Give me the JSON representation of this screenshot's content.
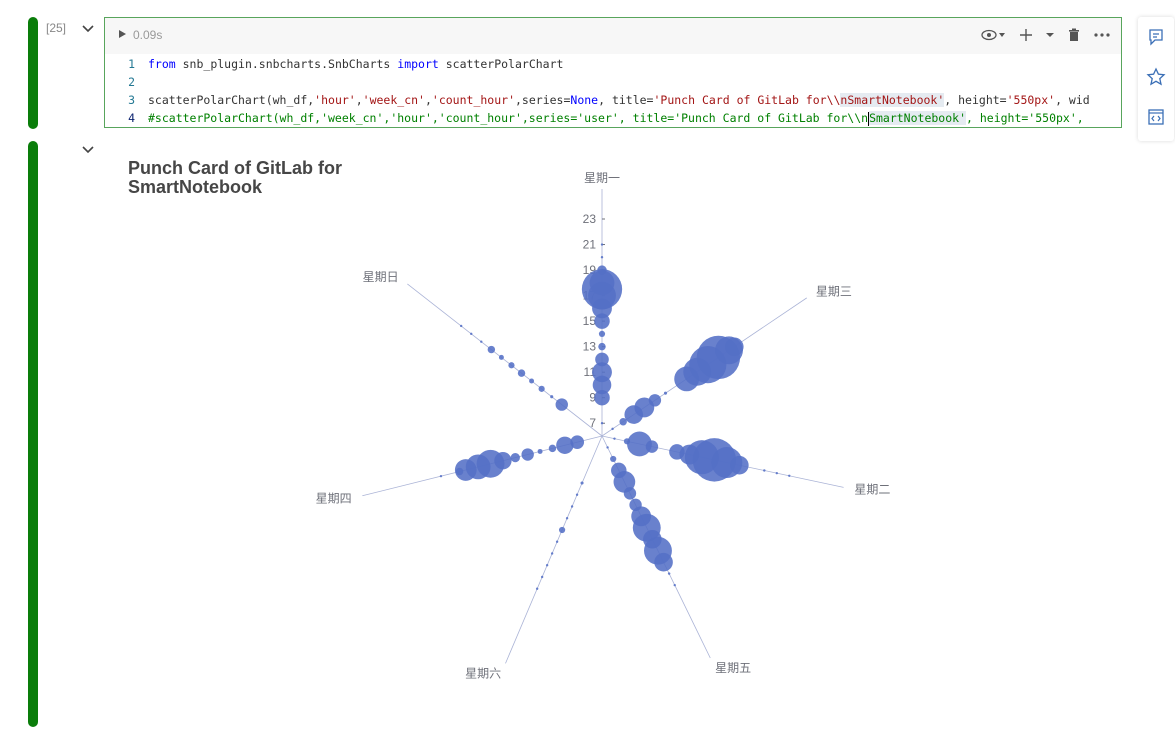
{
  "cell": {
    "execution_count": "[25]",
    "run_time": "0.09s",
    "code_lines": [
      {
        "number": "1",
        "segments": [
          {
            "t": "from",
            "c": "kw"
          },
          {
            "t": " snb_plugin.snbcharts.SnbCharts ",
            "c": ""
          },
          {
            "t": "import",
            "c": "kw"
          },
          {
            "t": " scatterPolarChart",
            "c": ""
          }
        ]
      },
      {
        "number": "2",
        "segments": []
      },
      {
        "number": "3",
        "segments": [
          {
            "t": "scatterPolarChart(wh_df,",
            "c": ""
          },
          {
            "t": "'hour'",
            "c": "str"
          },
          {
            "t": ",",
            "c": ""
          },
          {
            "t": "'week_cn'",
            "c": "str"
          },
          {
            "t": ",",
            "c": ""
          },
          {
            "t": "'count_hour'",
            "c": "str"
          },
          {
            "t": ",series=",
            "c": ""
          },
          {
            "t": "None",
            "c": "kw"
          },
          {
            "t": ", title=",
            "c": ""
          },
          {
            "t": "'Punch Card of GitLab for\\\\",
            "c": "str"
          },
          {
            "t": "nSmartNotebook'",
            "c": "str hl"
          },
          {
            "t": ", height=",
            "c": ""
          },
          {
            "t": "'550px'",
            "c": "str"
          },
          {
            "t": ", wid",
            "c": ""
          }
        ]
      },
      {
        "number": "4",
        "segments": [
          {
            "t": "#scatterPolarChart(wh_df,'week_cn','hour','count_hour',series='user', title='Punch Card of GitLab for\\\\n",
            "c": "cm"
          },
          {
            "t": "|",
            "c": "cursor"
          },
          {
            "t": "SmartNotebook'",
            "c": "cm hl"
          },
          {
            "t": ", height='550px', ",
            "c": "cm"
          }
        ]
      }
    ]
  },
  "toolbar": {
    "icons": [
      "eye-icon",
      "dropdown-icon",
      "plus-icon",
      "dropdown-icon",
      "trash-icon",
      "more-icon"
    ]
  },
  "side_panel": {
    "icons": [
      "comment-icon",
      "star-icon",
      "code-view-icon"
    ]
  },
  "chart_data": {
    "type": "scatter",
    "subtype": "polar-punch-card",
    "title": "Punch Card of GitLab for\nSmartNotebook",
    "angle_categories": [
      "星期一",
      "星期三",
      "星期二",
      "星期五",
      "星期六",
      "星期四",
      "星期日"
    ],
    "radius_axis_ticks": [
      "7",
      "9",
      "11",
      "13",
      "15",
      "17",
      "19",
      "21",
      "23"
    ],
    "radius_range": [
      6,
      23
    ],
    "color": "#5470c6",
    "series": [
      {
        "category": "星期一",
        "points": [
          [
            7,
            0.3
          ],
          [
            9,
            2.5
          ],
          [
            10,
            3.0
          ],
          [
            11,
            3.2
          ],
          [
            12,
            2.2
          ],
          [
            13,
            1.2
          ],
          [
            14,
            1.0
          ],
          [
            15,
            2.5
          ],
          [
            16,
            3.2
          ],
          [
            17,
            4.5
          ],
          [
            17.5,
            6.5
          ],
          [
            18,
            4.0
          ],
          [
            19,
            1.5
          ],
          [
            20,
            0.4
          ],
          [
            21,
            0.3
          ]
        ]
      },
      {
        "category": "星期三",
        "points": [
          [
            7,
            0.4
          ],
          [
            8,
            1.2
          ],
          [
            9,
            3.0
          ],
          [
            10,
            3.2
          ],
          [
            11,
            2.0
          ],
          [
            12,
            0.5
          ],
          [
            14,
            4.0
          ],
          [
            15,
            4.5
          ],
          [
            16,
            6.0
          ],
          [
            17,
            7.0
          ],
          [
            18,
            4.5
          ],
          [
            18.5,
            3.0
          ]
        ]
      },
      {
        "category": "星期二",
        "points": [
          [
            7,
            0.3
          ],
          [
            8,
            1.0
          ],
          [
            9,
            4.0
          ],
          [
            10,
            2.0
          ],
          [
            12,
            2.5
          ],
          [
            13,
            3.2
          ],
          [
            14,
            5.5
          ],
          [
            15,
            7.0
          ],
          [
            16,
            5.0
          ],
          [
            17,
            3.0
          ],
          [
            19,
            0.4
          ],
          [
            20,
            0.3
          ],
          [
            21,
            0.3
          ]
        ]
      },
      {
        "category": "星期五",
        "points": [
          [
            7,
            0.3
          ],
          [
            8,
            1.0
          ],
          [
            9,
            2.5
          ],
          [
            10,
            3.5
          ],
          [
            11,
            2.0
          ],
          [
            12,
            2.0
          ],
          [
            13,
            3.2
          ],
          [
            14,
            4.5
          ],
          [
            15,
            3.0
          ],
          [
            16,
            4.5
          ],
          [
            17,
            3.0
          ],
          [
            18,
            0.4
          ],
          [
            19,
            0.3
          ]
        ]
      },
      {
        "category": "星期六",
        "points": [
          [
            10,
            0.5
          ],
          [
            11,
            0.3
          ],
          [
            12,
            0.3
          ],
          [
            13,
            0.3
          ],
          [
            14,
            1.0
          ],
          [
            15,
            0.3
          ],
          [
            16,
            0.3
          ],
          [
            17,
            0.3
          ],
          [
            18,
            0.3
          ],
          [
            19,
            0.3
          ]
        ]
      },
      {
        "category": "星期四",
        "points": [
          [
            8,
            2.2
          ],
          [
            9,
            2.8
          ],
          [
            10,
            1.2
          ],
          [
            11,
            0.8
          ],
          [
            12,
            2.0
          ],
          [
            13,
            1.5
          ],
          [
            14,
            2.8
          ],
          [
            15,
            4.5
          ],
          [
            16,
            4.0
          ],
          [
            17,
            3.5
          ],
          [
            17.5,
            1.2
          ],
          [
            19,
            0.3
          ]
        ]
      },
      {
        "category": "星期日",
        "points": [
          [
            10,
            2.0
          ],
          [
            11,
            0.5
          ],
          [
            12,
            1.0
          ],
          [
            13,
            0.8
          ],
          [
            14,
            1.2
          ],
          [
            15,
            1.0
          ],
          [
            16,
            0.8
          ],
          [
            17,
            1.2
          ],
          [
            18,
            0.3
          ],
          [
            19,
            0.3
          ],
          [
            20,
            0.3
          ]
        ]
      }
    ]
  }
}
